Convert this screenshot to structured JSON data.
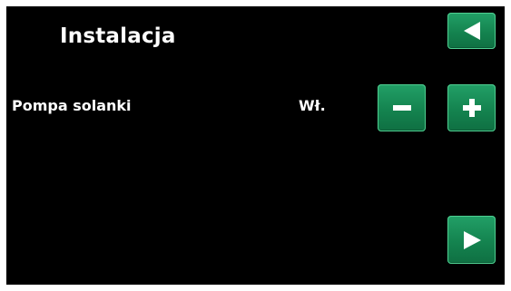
{
  "header": {
    "title": "Instalacja",
    "back_icon": "triangle-left-icon"
  },
  "setting": {
    "label": "Pompa solanki",
    "value": "Wł.",
    "decrease_icon": "minus-icon",
    "increase_icon": "plus-icon"
  },
  "footer": {
    "next_icon": "triangle-right-icon"
  },
  "colors": {
    "background": "#000000",
    "button_green": "#14834f",
    "text": "#ffffff"
  }
}
